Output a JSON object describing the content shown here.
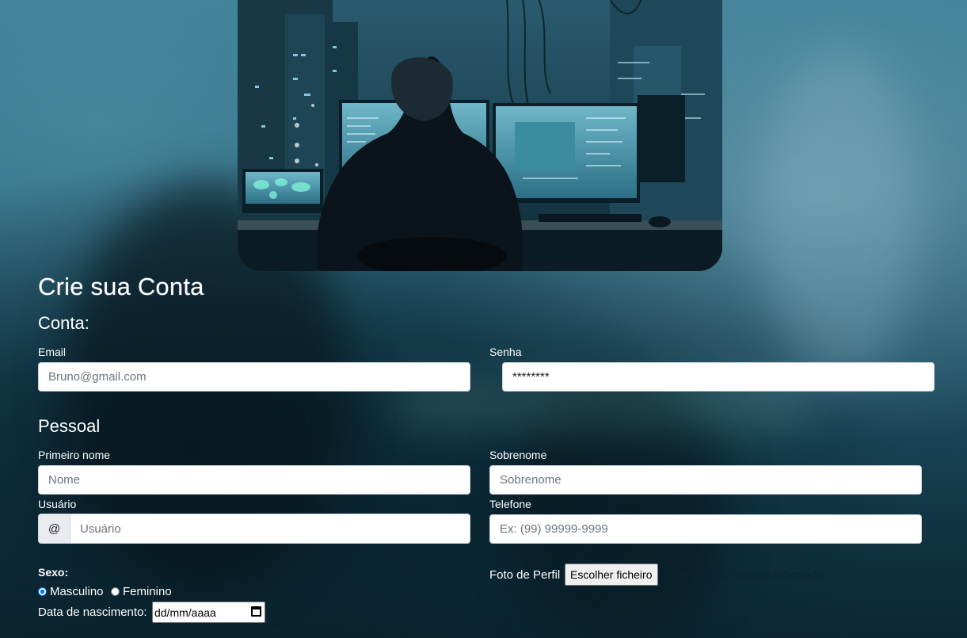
{
  "page_title": "Crie sua Conta",
  "sections": {
    "conta": "Conta:",
    "pessoal": "Pessoal"
  },
  "conta": {
    "email_label": "Email",
    "email_value": "Bruno@gmail.com",
    "senha_label": "Senha",
    "senha_value": "********"
  },
  "pessoal": {
    "primeiro_nome_label": "Primeiro nome",
    "primeiro_nome_placeholder": "Nome",
    "sobrenome_label": "Sobrenome",
    "sobrenome_placeholder": "Sobrenome",
    "usuario_label": "Usuário",
    "usuario_prefix": "@",
    "usuario_placeholder": "Usuário",
    "telefone_label": "Telefone",
    "telefone_placeholder": "Ex: (99) 99999-9999"
  },
  "sexo": {
    "label": "Sexo:",
    "options": [
      "Masculino",
      "Feminino"
    ],
    "selected": "Masculino"
  },
  "nascimento": {
    "label": "Data de nascimento:",
    "placeholder": "dd/mm/aaaa"
  },
  "foto": {
    "label": "Foto de Perfil",
    "button": "Escolher ficheiro",
    "status": "Nenhum ficheiro selecionado"
  },
  "colors": {
    "radio_accent": "#0075ff",
    "text": "#ffffff"
  }
}
